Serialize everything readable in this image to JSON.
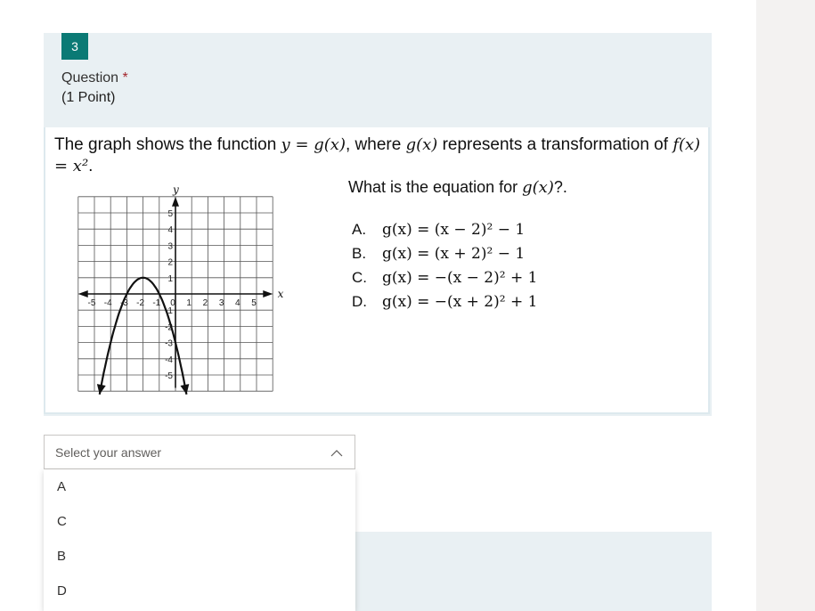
{
  "question": {
    "number": "3",
    "label": "Question",
    "required_mark": "*",
    "points": "(1 Point)"
  },
  "content": {
    "stem_part1": "The graph shows the function",
    "stem_expr1": "y = g(x)",
    "stem_part2": ", where",
    "stem_expr2": "g(x)",
    "stem_part3": "represents a transformation of",
    "stem_expr3": "f(x) = x²",
    "stem_end": ".",
    "prompt_text": "What is the equation for",
    "prompt_expr": "g(x)",
    "prompt_end": "?.",
    "choices": [
      {
        "letter": "A.",
        "equation": "g(x) = (x − 2)² − 1"
      },
      {
        "letter": "B.",
        "equation": "g(x) = (x + 2)² − 1"
      },
      {
        "letter": "C.",
        "equation": "g(x) = −(x − 2)² + 1"
      },
      {
        "letter": "D.",
        "equation": "g(x) = −(x + 2)² + 1"
      }
    ],
    "graph": {
      "x_axis_label": "x",
      "y_axis_label": "y",
      "x_tick_labels": [
        "-5",
        "-4",
        "-3",
        "-2",
        "-1",
        "0",
        "1",
        "2",
        "3",
        "4",
        "5"
      ],
      "y_tick_labels": [
        "5",
        "4",
        "3",
        "2",
        "1",
        "-1",
        "-2",
        "-3",
        "-4",
        "-5"
      ],
      "xlim": [
        -6,
        6
      ],
      "ylim": [
        -6,
        6
      ],
      "curve": {
        "vertex_x": -2,
        "vertex_y": 1,
        "a": -1
      }
    }
  },
  "answer": {
    "placeholder": "Select your answer",
    "options": [
      "A",
      "C",
      "B",
      "D"
    ]
  },
  "colors": {
    "accent": "#0b7a75",
    "card_bg": "#e9f0f3",
    "required": "#a4262c"
  }
}
